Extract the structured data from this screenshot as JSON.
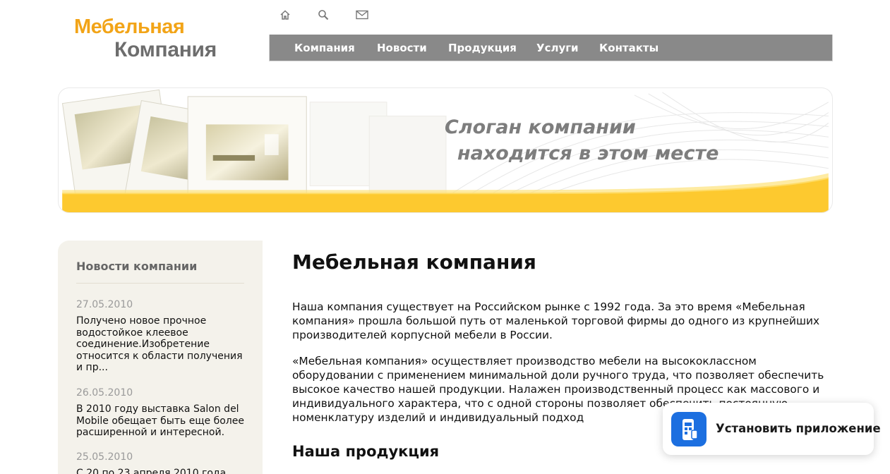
{
  "logo": {
    "line1": "Мебельная",
    "line2": "Компания"
  },
  "top_icons": [
    "home-icon",
    "search-icon",
    "mail-icon"
  ],
  "nav": {
    "items": [
      "Компания",
      "Новости",
      "Продукция",
      "Услуги",
      "Контакты"
    ]
  },
  "banner": {
    "slogan_line1": "Слоган компании",
    "slogan_line2": "находится в этом месте"
  },
  "sidebar": {
    "title": "Новости компании",
    "news": [
      {
        "date": "27.05.2010",
        "text": "Получено новое прочное водостойкое клеевое соединение.Изобретение относится к области получения и пр..."
      },
      {
        "date": "26.05.2010",
        "text": "В 2010 году выставка Salon del Mobile обещает быть еще более расширенной и интересной."
      },
      {
        "date": "25.05.2010",
        "text": "С 20 по 23 апреля 2010 года"
      }
    ]
  },
  "main": {
    "title": "Мебельная компания",
    "paragraphs": [
      "Наша компания существует на Российском рынке с 1992 года. За это время «Мебельная компания» прошла большой путь от маленькой торговой фирмы до одного из крупнейших производителей корпусной мебели в России.",
      "«Мебельная компания» осуществляет производство мебели на высококлассном оборудовании с применением минимальной доли ручного труда, что позволяет обеспечить высокое качество нашей продукции. Налажен производственный процесс как массового и индивидуального характера, что с одной стороны позволяет обеспечить постоянную номенклатуру изделий и индивидуальный подход"
    ],
    "subheading": "Наша продукция"
  },
  "install_popup": {
    "label": "Установить приложение"
  },
  "colors": {
    "logo_orange": "#f2a417",
    "logo_gray": "#6d6d6d",
    "nav_bg": "#898989",
    "banner_yellow": "#fdc92f",
    "sidebar_bg": "#f4f2eb",
    "install_icon": "#1c6fe0"
  }
}
